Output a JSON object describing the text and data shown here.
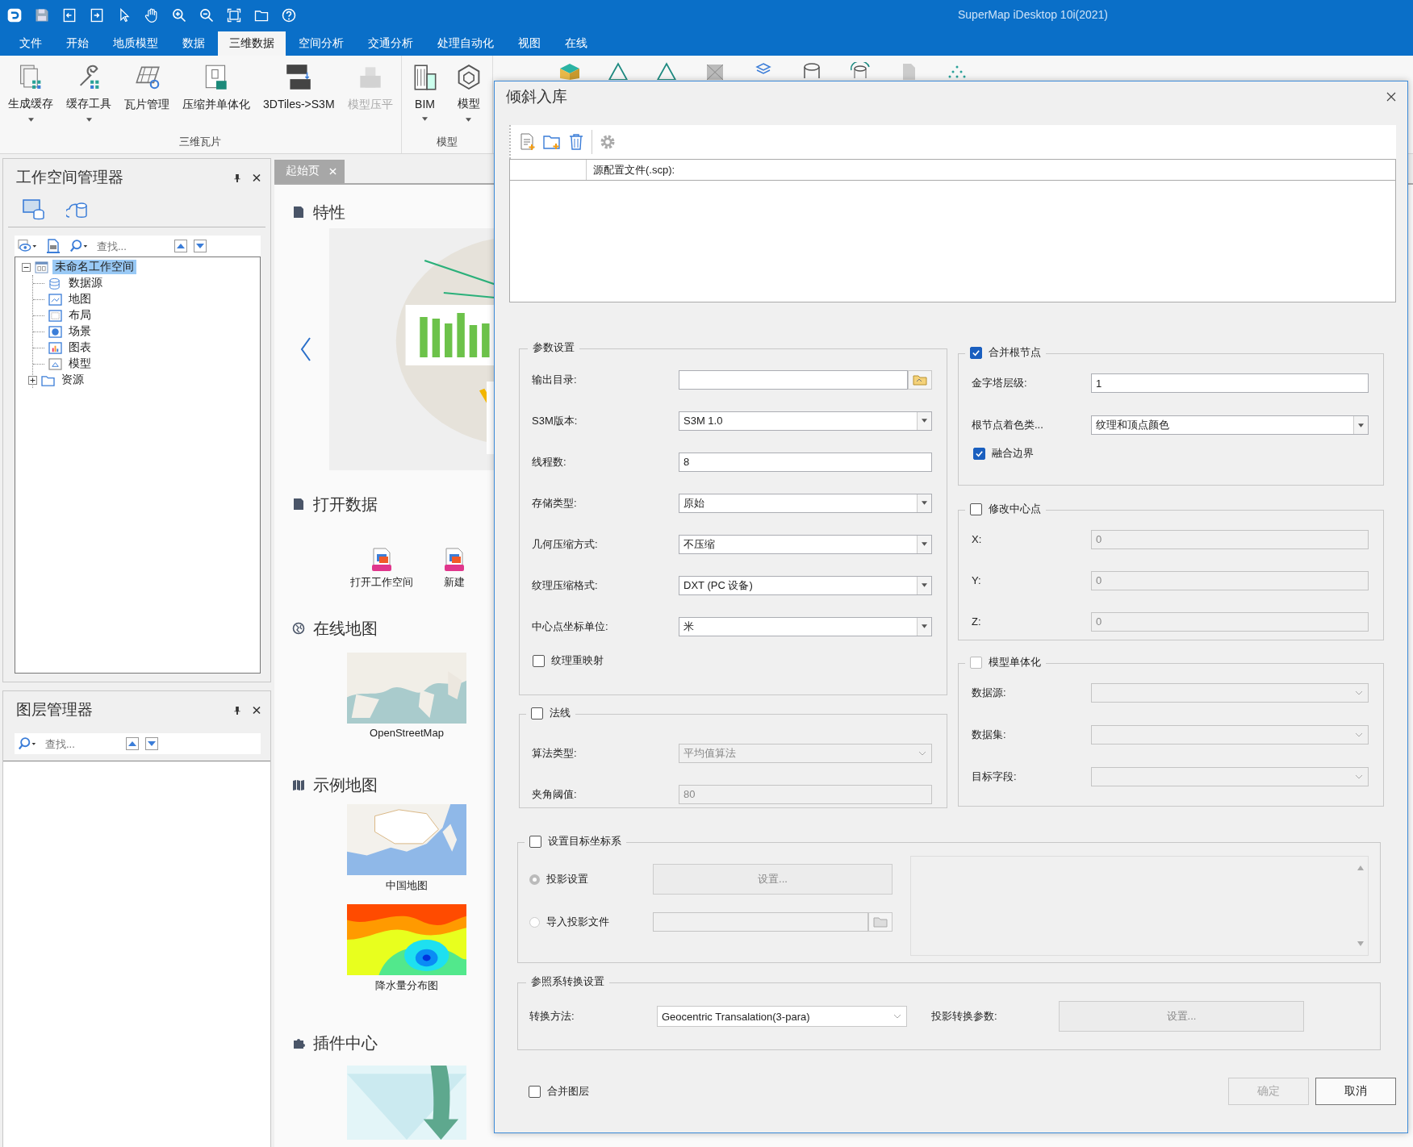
{
  "title_bar": {
    "title": "SuperMap iDesktop 10i(2021)",
    "tools": [
      {
        "kind": "logo"
      },
      {
        "kind": "save"
      },
      {
        "kind": "import"
      },
      {
        "kind": "export"
      },
      {
        "kind": "pointer"
      },
      {
        "kind": "hand"
      },
      {
        "kind": "zoom-in"
      },
      {
        "kind": "zoom-out"
      },
      {
        "kind": "extent"
      },
      {
        "kind": "folder"
      },
      {
        "kind": "help"
      }
    ]
  },
  "menu_tabs": [
    {
      "label": "文件",
      "selected": false
    },
    {
      "label": "开始",
      "selected": false
    },
    {
      "label": "地质模型",
      "selected": false
    },
    {
      "label": "数据",
      "selected": false
    },
    {
      "label": "三维数据",
      "selected": true
    },
    {
      "label": "空间分析",
      "selected": false
    },
    {
      "label": "交通分析",
      "selected": false
    },
    {
      "label": "处理自动化",
      "selected": false
    },
    {
      "label": "视图",
      "selected": false
    },
    {
      "label": "在线",
      "selected": false
    }
  ],
  "ribbon": {
    "groups": [
      {
        "label": "三维瓦片",
        "buttons": [
          {
            "label": "生成缓存",
            "kind": "cache",
            "dropdown": true,
            "disabled": false
          },
          {
            "label": "缓存工具",
            "kind": "tools",
            "dropdown": true,
            "disabled": false
          },
          {
            "label": "瓦片管理",
            "kind": "tiles",
            "dropdown": false,
            "disabled": false
          },
          {
            "label": "压缩并单体化",
            "kind": "compress",
            "dropdown": false,
            "disabled": false
          },
          {
            "label": "3DTiles->S3M",
            "kind": "convert",
            "dropdown": false,
            "disabled": false
          },
          {
            "label": "模型压平",
            "kind": "flatten",
            "dropdown": false,
            "disabled": true
          }
        ]
      },
      {
        "label": "模型",
        "buttons": [
          {
            "label": "BIM",
            "kind": "bim",
            "dropdown": true,
            "disabled": false
          },
          {
            "label": "模型",
            "kind": "model",
            "dropdown": true,
            "disabled": false
          }
        ]
      }
    ]
  },
  "workspace_manager": {
    "title": "工作空间管理器",
    "search": {
      "placeholder": "查找..."
    },
    "tree": [
      {
        "label": "未命名工作空间",
        "kind": "workspace",
        "selected": true,
        "expanded": true,
        "children": [
          {
            "label": "数据源",
            "kind": "datasource",
            "selected": false
          },
          {
            "label": "地图",
            "kind": "map",
            "selected": false
          },
          {
            "label": "布局",
            "kind": "layout",
            "selected": false
          },
          {
            "label": "场景",
            "kind": "scene",
            "selected": false
          },
          {
            "label": "图表",
            "kind": "chart",
            "selected": false
          },
          {
            "label": "模型",
            "kind": "model",
            "selected": false
          },
          {
            "label": "资源",
            "kind": "resource",
            "selected": false,
            "expanded": false
          }
        ]
      }
    ]
  },
  "layer_manager": {
    "title": "图层管理器",
    "search": {
      "placeholder": "查找..."
    }
  },
  "start_page": {
    "tab": "起始页",
    "sections": [
      {
        "kind": "features",
        "title": "特性"
      },
      {
        "kind": "open",
        "title": "打开数据",
        "items": [
          "打开工作空间",
          "新建"
        ]
      },
      {
        "kind": "online",
        "title": "在线地图",
        "items": [
          "OpenStreetMap"
        ]
      },
      {
        "kind": "samples",
        "title": "示例地图",
        "items": [
          "中国地图",
          "降水量分布图"
        ]
      },
      {
        "kind": "plugins",
        "title": "插件中心"
      }
    ]
  },
  "dialog": {
    "title": "倾斜入库",
    "table": {
      "columns": [
        "源配置文件(.scp):"
      ]
    },
    "params": {
      "title": "参数设置",
      "rows": [
        {
          "label": "输出目录:",
          "kind": "path",
          "disabled": false
        },
        {
          "label": "S3M版本:",
          "kind": "select",
          "value": "S3M 1.0",
          "disabled": false
        },
        {
          "label": "线程数:",
          "kind": "text",
          "value": "8",
          "disabled": false
        },
        {
          "label": "存储类型:",
          "kind": "select",
          "value": "原始",
          "disabled": false
        },
        {
          "label": "几何压缩方式:",
          "kind": "select",
          "value": "不压缩",
          "disabled": false
        },
        {
          "label": "纹理压缩格式:",
          "kind": "select",
          "value": "DXT (PC 设备)",
          "disabled": false
        },
        {
          "label": "中心点坐标单位:",
          "kind": "select",
          "value": "米",
          "disabled": false
        }
      ],
      "checkbox": {
        "label": "纹理重映射",
        "checked": false
      }
    },
    "normals": {
      "title": "法线",
      "checked": false,
      "disabled": false,
      "rows": [
        {
          "label": "算法类型:",
          "kind": "select",
          "value": "平均值算法",
          "disabled": true
        },
        {
          "label": "夹角阈值:",
          "kind": "text",
          "value": "80",
          "disabled": true
        }
      ]
    },
    "merge_root": {
      "title": "合并根节点",
      "checked": true,
      "disabled": false,
      "rows": [
        {
          "label": "金字塔层级:",
          "kind": "text",
          "value": "1",
          "disabled": false
        },
        {
          "label": "根节点着色类...",
          "kind": "select",
          "value": "纹理和顶点颜色",
          "disabled": false
        }
      ],
      "checkbox": {
        "label": "融合边界",
        "checked": true
      }
    },
    "center_point": {
      "title": "修改中心点",
      "checked": false,
      "disabled": false,
      "rows": [
        {
          "label": "X:",
          "kind": "text",
          "value": "0",
          "disabled": true
        },
        {
          "label": "Y:",
          "kind": "text",
          "value": "0",
          "disabled": true
        },
        {
          "label": "Z:",
          "kind": "text",
          "value": "0",
          "disabled": true
        }
      ]
    },
    "monomer": {
      "title": "模型单体化",
      "checked": false,
      "disabled": true,
      "rows": [
        {
          "label": "数据源:",
          "kind": "select",
          "disabled": true
        },
        {
          "label": "数据集:",
          "kind": "select",
          "disabled": true
        },
        {
          "label": "目标字段:",
          "kind": "select",
          "disabled": true
        }
      ]
    },
    "target_crs": {
      "title": "设置目标坐标系",
      "checked": false,
      "options": [
        {
          "label": "投影设置",
          "selected": true,
          "disabled": true,
          "kind": "button",
          "button": "设置..."
        },
        {
          "label": "导入投影文件",
          "selected": false,
          "disabled": true,
          "kind": "path"
        }
      ]
    },
    "transform": {
      "title": "参照系转换设置",
      "method_label": "转换方法:",
      "method": "Geocentric Transalation(3-para)",
      "param_label": "投影转换参数:",
      "param_button": "设置..."
    },
    "merge_layers": {
      "label": "合并图层",
      "checked": false
    },
    "buttons": [
      {
        "label": "确定",
        "disabled": true
      },
      {
        "label": "取消",
        "disabled": false
      }
    ]
  }
}
